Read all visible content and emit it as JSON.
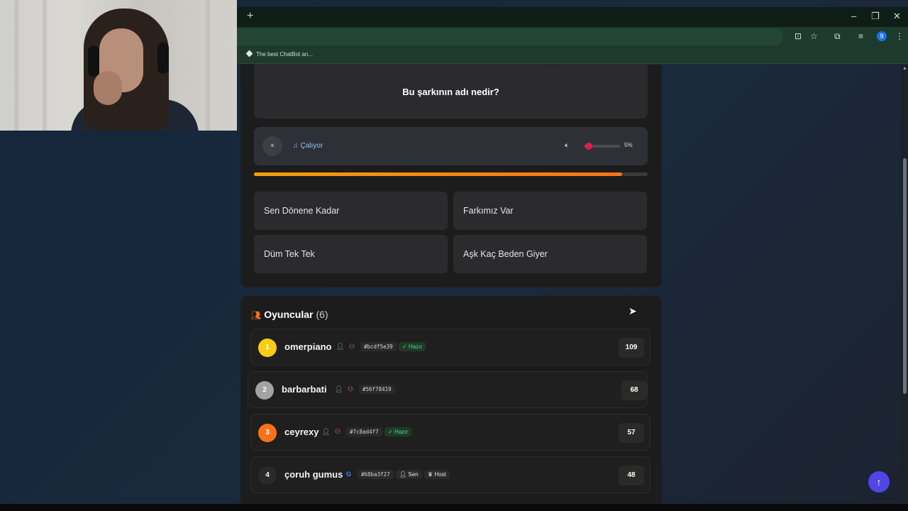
{
  "browser": {
    "new_tab": "+",
    "controls": {
      "minimize": "–",
      "restore": "❐",
      "close": "✕"
    },
    "bookmark": "The best ChatBot an...",
    "profile_initial": "9"
  },
  "question": {
    "text": "Bu şarkının adı nedir?"
  },
  "player": {
    "pause_icon": "⏸",
    "status": "Çalıyor",
    "volume_text": "5%",
    "volume_level": 0.05,
    "progress_level": 0.935
  },
  "answers": [
    {
      "label": "Sen Dönene Kadar"
    },
    {
      "label": "Farkımız Var"
    },
    {
      "label": "Düm Tek Tek"
    },
    {
      "label": "Aşk Kaç Beden Giyer"
    }
  ],
  "players": {
    "title": "Oyuncular",
    "count": "(6)",
    "rows": [
      {
        "rank": "1",
        "name": "omerpiano",
        "id": "#bcdf5e39",
        "ready": "Hazır",
        "score": "109",
        "rank_color": "#facc15"
      },
      {
        "rank": "2",
        "name": "barbarbati",
        "id": "#56f78419",
        "score": "68",
        "rank_color": "#a3a3a3"
      },
      {
        "rank": "3",
        "name": "ceyrexy",
        "id": "#7c8ad4f7",
        "ready": "Hazır",
        "score": "57",
        "rank_color": "#f97316"
      },
      {
        "rank": "4",
        "name": "çoruh gumus",
        "id": "#68ba3f27",
        "you": "Sen",
        "host": "Host",
        "score": "48",
        "rank_color": "#2a2a2c"
      }
    ]
  },
  "colors": {
    "accent_orange": "#f97316",
    "volume_red": "#e11d48",
    "ready_green": "#4ade80",
    "back_top": "#4f46e5"
  },
  "icons": {
    "back_to_top": "↑"
  }
}
